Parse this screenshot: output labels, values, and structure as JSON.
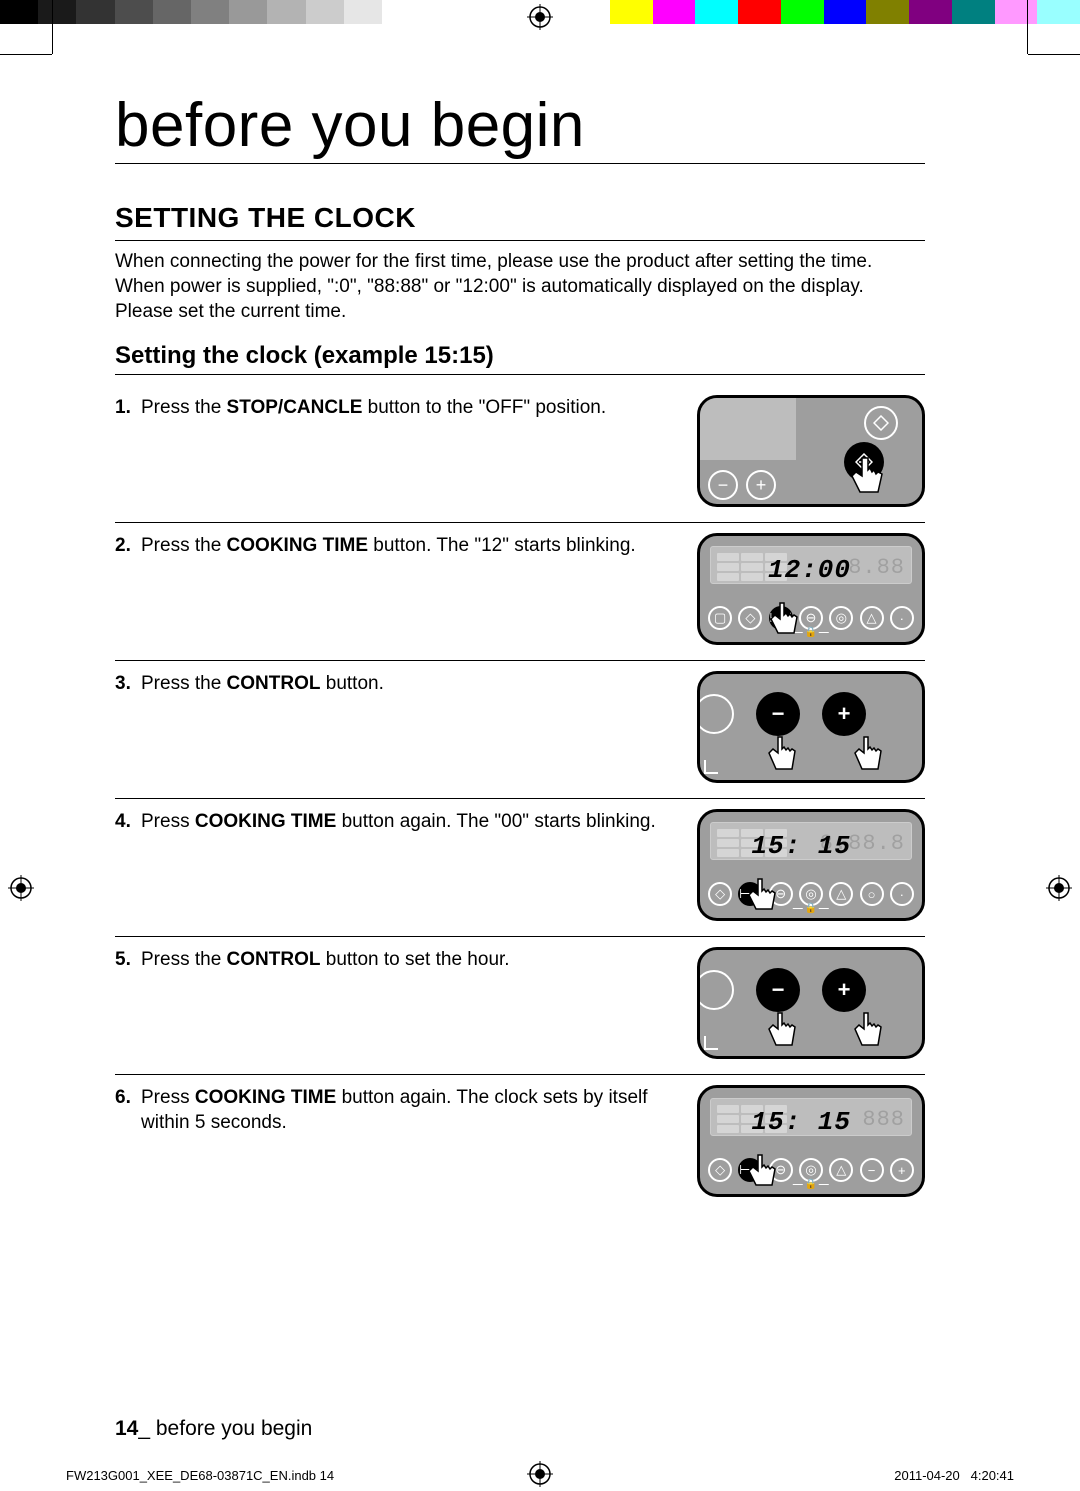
{
  "page_title": "before you begin",
  "section_title": "SETTING THE CLOCK",
  "intro": "When connecting the power for the first time, please use the product after setting the time. When power is supplied, \":0\", \"88:88\" or \"12:00\" is automatically displayed on the display. Please set the current time.",
  "subsection_title": "Setting the clock (example 15:15)",
  "steps": [
    {
      "pre": "Press the ",
      "bold": "STOP/CANCLE",
      "post": " button to the \"OFF\" position.",
      "time": ""
    },
    {
      "pre": "Press the ",
      "bold": "COOKING TIME",
      "post": " button. The \"12\" starts blinking.",
      "time": "12:00"
    },
    {
      "pre": "Press the ",
      "bold": "CONTROL",
      "post": " button.",
      "time": ""
    },
    {
      "pre": "Press ",
      "bold": "COOKING TIME",
      "post": " button again. The \"00\" starts blinking.",
      "time": "15: 15"
    },
    {
      "pre": "Press the ",
      "bold": "CONTROL",
      "post": " button to set the hour.",
      "time": ""
    },
    {
      "pre": "Press ",
      "bold": "COOKING TIME",
      "post": " button again. The clock sets by itself within 5 seconds.",
      "time": "15: 15"
    }
  ],
  "footer": {
    "page_num": "14",
    "sep": "_ ",
    "label": "before you begin"
  },
  "imprint": {
    "file": "FW213G001_XEE_DE68-03871C_EN.indb   14",
    "date": "2011-04-20",
    "time": "4:20:41"
  },
  "icons": {
    "minus": "−",
    "plus": "+",
    "lock": "🔒"
  },
  "colors": {
    "calib_left": [
      "#000000",
      "#1a1a1a",
      "#333333",
      "#4d4d4d",
      "#666666",
      "#808080",
      "#999999",
      "#b3b3b3",
      "#cccccc",
      "#e6e6e6",
      "#ffffff"
    ],
    "calib_right": [
      "#ffff00",
      "#ff00ff",
      "#00ffff",
      "#ff0000",
      "#00ff00",
      "#0000ff",
      "#808000",
      "#800080",
      "#008080",
      "#ff99ff",
      "#99ffff"
    ]
  }
}
